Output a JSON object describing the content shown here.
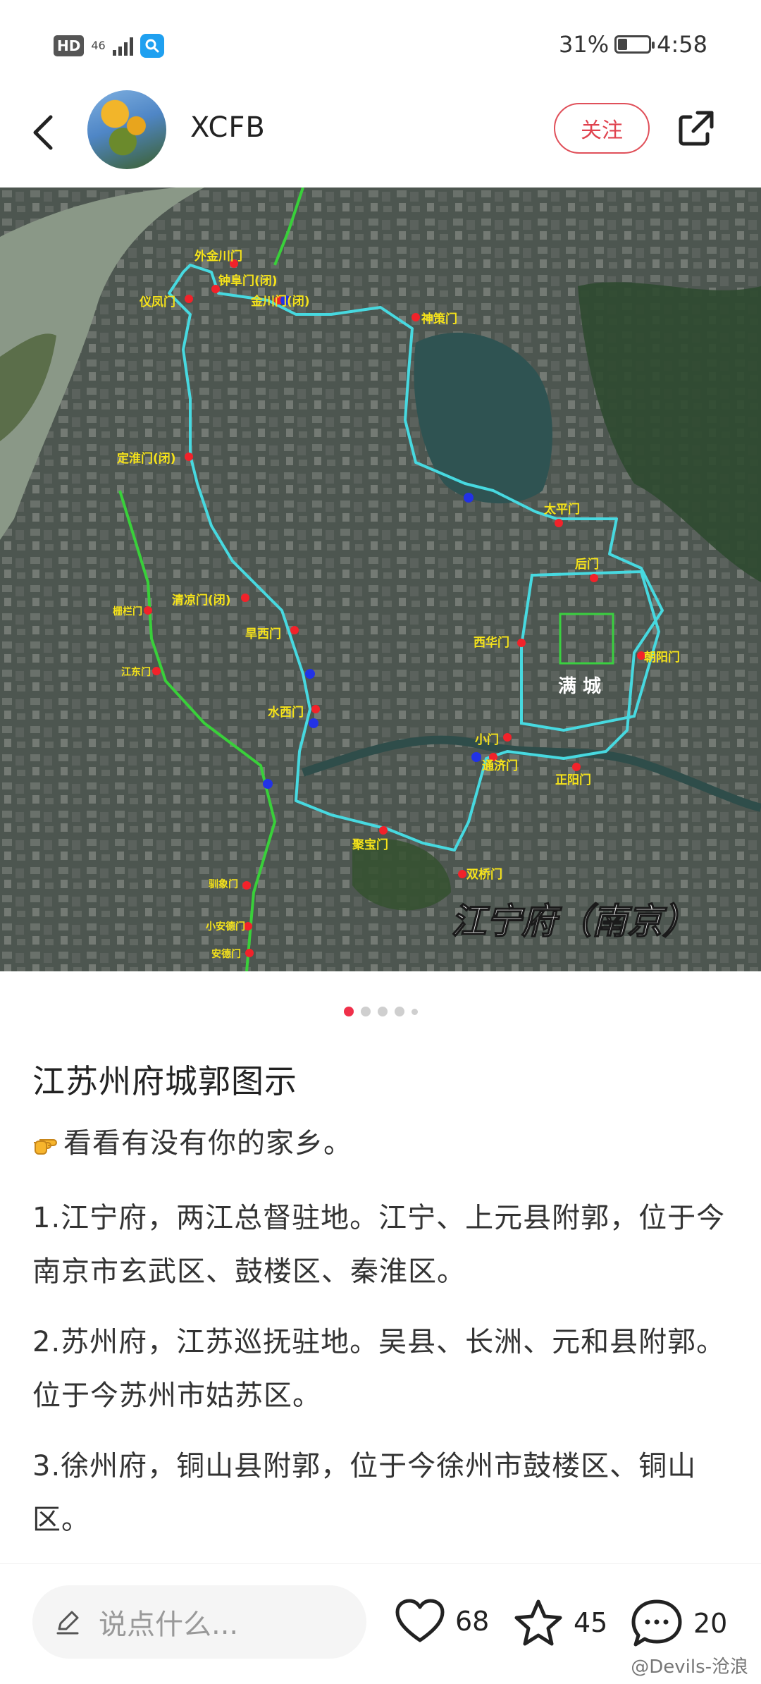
{
  "status_bar": {
    "hd_badge": "HD",
    "network": "46",
    "battery_text": "31%",
    "battery_level": 0.31,
    "time": "4:58"
  },
  "header": {
    "username": "XCFB",
    "follow_label": "关注"
  },
  "map": {
    "caption": "江宁府（南京）",
    "district_label": "满 城",
    "gates": [
      "外金川门",
      "钟阜门(闭)",
      "金川门(闭)",
      "仪凤门",
      "神策门",
      "定淮门(闭)",
      "太平门",
      "后门",
      "清凉门(闭)",
      "西华门",
      "朝阳门",
      "旱西门",
      "水西门",
      "小门",
      "通济门",
      "正阳门",
      "聚宝门",
      "双桥门",
      "栅栏门",
      "江东门",
      "驯象门",
      "小安德门",
      "安德门"
    ]
  },
  "pager": {
    "total": 5,
    "active": 0
  },
  "post": {
    "title": "江苏州府城郭图示",
    "intro": "看看有没有你的家乡。",
    "paragraphs": [
      "1.江宁府，两江总督驻地。江宁、上元县附郭，位于今南京市玄武区、鼓楼区、秦淮区。",
      "2.苏州府，江苏巡抚驻地。吴县、长洲、元和县附郭。位于今苏州市姑苏区。",
      "3.徐州府，铜山县附郭，位于今徐州市鼓楼区、铜山区。"
    ]
  },
  "bottom_bar": {
    "comment_placeholder": "说点什么...",
    "likes": "68",
    "favorites": "45",
    "comments": "20"
  },
  "watermark": "@Devils-沧浪"
}
